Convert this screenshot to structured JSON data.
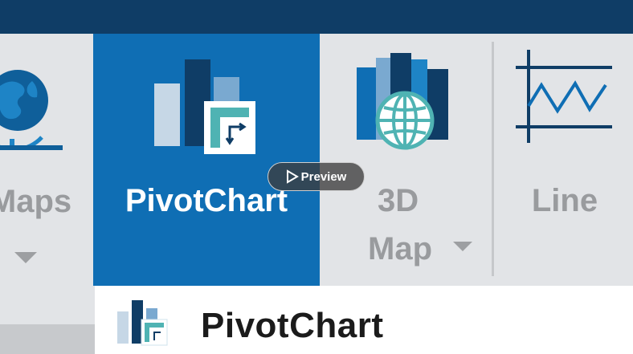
{
  "ribbon": {
    "maps": {
      "label": "Maps",
      "icon": "globe-icon",
      "has_dropdown": true
    },
    "pivotchart": {
      "label": "PivotChart",
      "icon": "pivotchart-icon",
      "selected": true
    },
    "map3d": {
      "label_line1": "3D",
      "label_line2": "Map",
      "icon": "3d-map-icon",
      "has_dropdown": true
    },
    "line": {
      "label": "Line",
      "icon": "line-sparkline-icon"
    }
  },
  "preview_button": {
    "label": "Preview",
    "icon": "play-icon"
  },
  "tooltip": {
    "title": "PivotChart",
    "icon": "pivotchart-icon"
  },
  "colors": {
    "titlebar": "#0f3d66",
    "ribbon_bg": "#e2e4e7",
    "selected_bg": "#0f6eb4",
    "disabled_text": "#999b9e",
    "accent_teal": "#4fb3b3"
  }
}
